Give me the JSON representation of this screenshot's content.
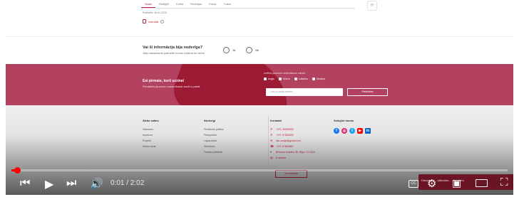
{
  "tabs": [
    "Skats",
    "Rediģēt",
    "Dzēst",
    "Revīzijas",
    "Klons",
    "Tulkot"
  ],
  "published": "Publicēts: 18.01.2023",
  "doc_label": "Izdrukāt",
  "feedback": {
    "question": "Vai šī informācija bija noderīga?",
    "subtitle": "Jūsu atsauksme palīdzēs mums uzlabot šo vietni",
    "yes": "Jā",
    "no": "Nē"
  },
  "banner": {
    "title": "Esi pirmais, kurš uzzina!",
    "subtitle": "Piesakies jaunumu saņemšanai savā e-pastā.",
    "lang_label": "Izvēlies jaunumu saņemšanas valodu:",
    "languages": [
      "Angļu",
      "Krievu",
      "Latviešu",
      "Ukraiņu"
    ],
    "email_placeholder": "Jūsu e-pasta adrese",
    "submit": "Pieteikties"
  },
  "footer": {
    "col1_title": "Ātrās saites",
    "col1_links": [
      "Vakances",
      "Iepirkumi",
      "Projekti",
      "Vietņu karte"
    ],
    "col2_title": "Noderīgi",
    "col2_links": [
      "Privātuma politika",
      "Pieejamība",
      "Lapas karte",
      "Sīkdatnes",
      "Finanšu pārskati"
    ],
    "contacts_title": "Kontakti",
    "contacts": [
      "+371 26282828",
      "+371 67882828",
      "sils.cadge@gmail.com",
      "+371 67882862",
      "Brīvības bulvāris 36, Rīga, LV-1520",
      "E-adrese"
    ],
    "social_title": "Sekojiet mums",
    "visit_btn": "Visi kontakti"
  },
  "video": {
    "time": "0:01 / 2:02",
    "progress": 0.01,
    "tooltip": "Danas Z... ...stāvoklis.. ...šo video"
  },
  "colors": {
    "accent": "#c0243a",
    "banner": "#b2425f",
    "progress": "#ff0000"
  }
}
